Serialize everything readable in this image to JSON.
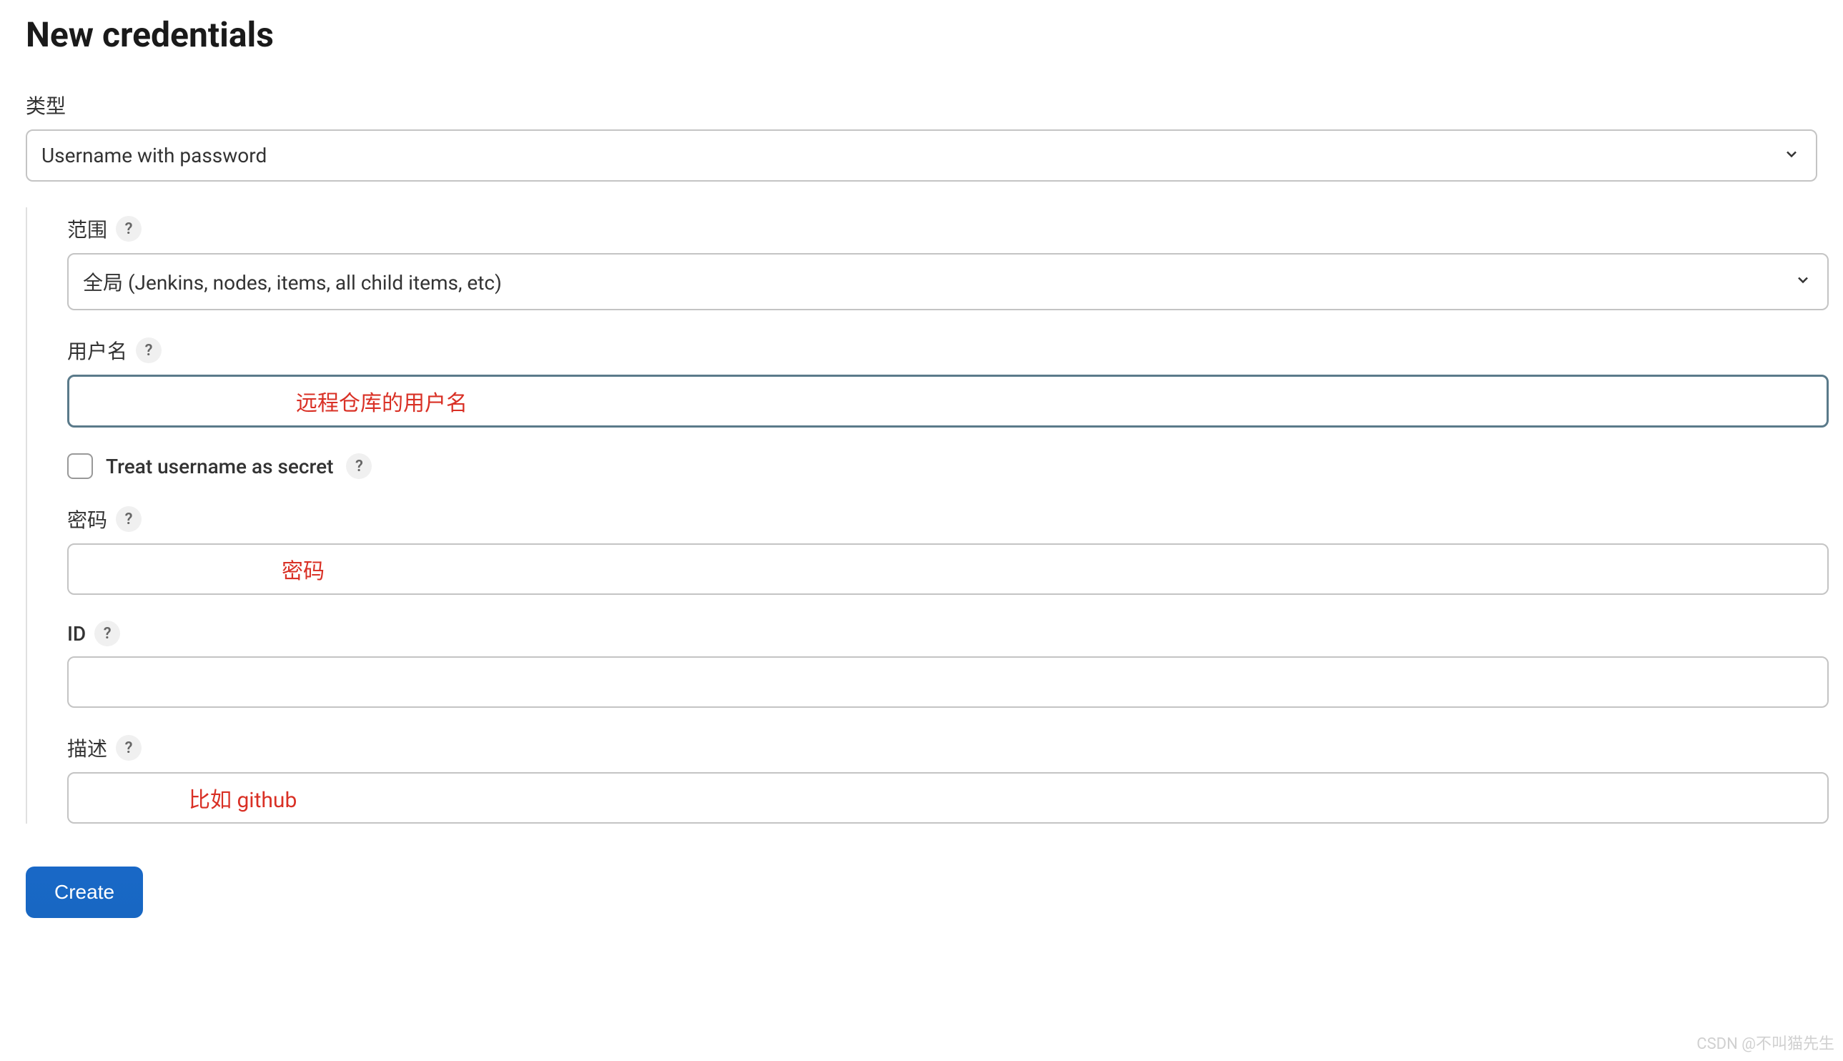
{
  "page": {
    "title": "New credentials"
  },
  "fields": {
    "type": {
      "label": "类型",
      "value": "Username with password"
    },
    "scope": {
      "label": "范围",
      "value": "全局 (Jenkins, nodes, items, all child items, etc)"
    },
    "username": {
      "label": "用户名",
      "value": "",
      "annotation": "远程仓库的用户名"
    },
    "treat_secret": {
      "label": "Treat username as secret",
      "checked": false
    },
    "password": {
      "label": "密码",
      "value": "",
      "annotation": "密码"
    },
    "id": {
      "label": "ID",
      "value": ""
    },
    "description": {
      "label": "描述",
      "value": "",
      "annotation": "比如 github"
    }
  },
  "actions": {
    "create": "Create"
  },
  "help_icon": "?",
  "watermark": "CSDN @不叫猫先生"
}
